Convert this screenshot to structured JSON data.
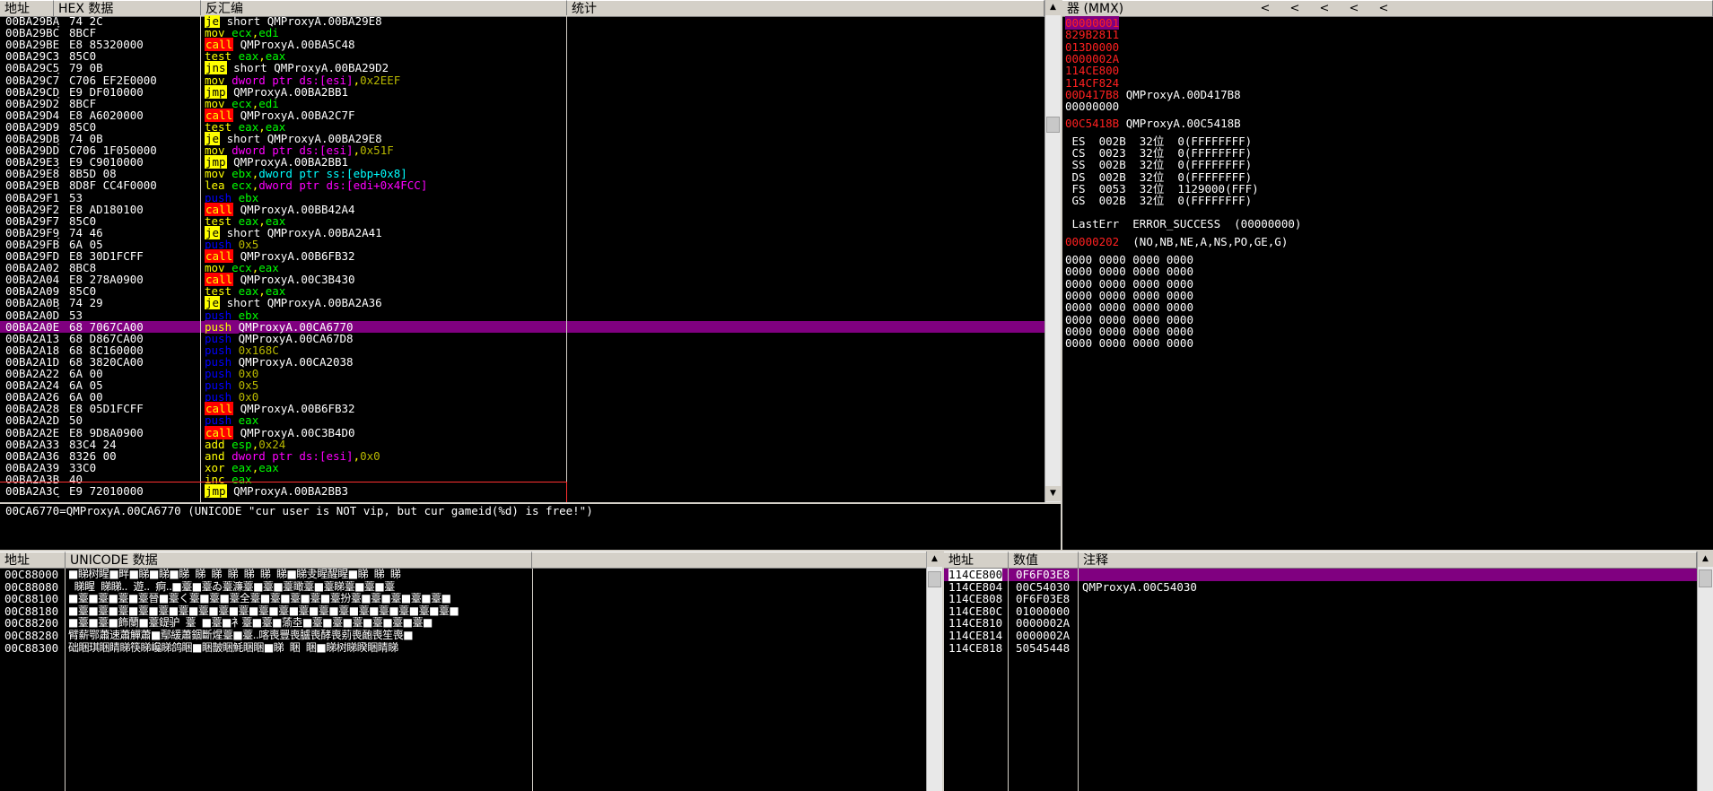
{
  "disasm": {
    "headers": {
      "addr": "地址",
      "hex": "HEX 数据",
      "asm": "反汇编",
      "comment": "统计"
    },
    "rows": [
      {
        "a": "00BA29BA",
        "m": "˯",
        "h": "74 2C",
        "i": [
          {
            "t": "je",
            "c": "k_je"
          },
          {
            "t": " short QMProxyA.00BA29E8",
            "c": "w"
          }
        ]
      },
      {
        "a": "00BA29BC",
        "m": "",
        "h": "8BCF",
        "i": [
          {
            "t": "mov ",
            "c": "y"
          },
          {
            "t": "ecx",
            "c": "g"
          },
          {
            "t": ",",
            "c": "y"
          },
          {
            "t": "edi",
            "c": "g"
          }
        ]
      },
      {
        "a": "00BA29BE",
        "m": "",
        "h": "E8 85320000",
        "i": [
          {
            "t": "call",
            "c": "k_call"
          },
          {
            "t": " QMProxyA.00BA5C48",
            "c": "w"
          }
        ]
      },
      {
        "a": "00BA29C3",
        "m": "",
        "h": "85C0",
        "i": [
          {
            "t": "test ",
            "c": "y"
          },
          {
            "t": "eax",
            "c": "g"
          },
          {
            "t": ",",
            "c": "y"
          },
          {
            "t": "eax",
            "c": "g"
          }
        ]
      },
      {
        "a": "00BA29C5",
        "m": "˯",
        "h": "79 0B",
        "i": [
          {
            "t": "jns",
            "c": "k_je"
          },
          {
            "t": " short QMProxyA.00BA29D2",
            "c": "w"
          }
        ]
      },
      {
        "a": "00BA29C7",
        "m": "",
        "h": "C706 EF2E0000",
        "i": [
          {
            "t": "mov ",
            "c": "y"
          },
          {
            "t": "dword ptr ",
            "c": "m"
          },
          {
            "t": "ds:[esi]",
            "c": "m"
          },
          {
            "t": ",",
            "c": "y"
          },
          {
            "t": "0x2EEF",
            "c": "o"
          }
        ]
      },
      {
        "a": "00BA29CD",
        "m": "˯",
        "h": "E9 DF010000",
        "i": [
          {
            "t": "jmp",
            "c": "k_jmp"
          },
          {
            "t": " QMProxyA.00BA2BB1",
            "c": "w"
          }
        ]
      },
      {
        "a": "00BA29D2",
        "m": "",
        "h": "8BCF",
        "i": [
          {
            "t": "mov ",
            "c": "y"
          },
          {
            "t": "ecx",
            "c": "g"
          },
          {
            "t": ",",
            "c": "y"
          },
          {
            "t": "edi",
            "c": "g"
          }
        ]
      },
      {
        "a": "00BA29D4",
        "m": "",
        "h": "E8 A6020000",
        "i": [
          {
            "t": "call",
            "c": "k_call"
          },
          {
            "t": " QMProxyA.00BA2C7F",
            "c": "w"
          }
        ]
      },
      {
        "a": "00BA29D9",
        "m": "",
        "h": "85C0",
        "i": [
          {
            "t": "test ",
            "c": "y"
          },
          {
            "t": "eax",
            "c": "g"
          },
          {
            "t": ",",
            "c": "y"
          },
          {
            "t": "eax",
            "c": "g"
          }
        ]
      },
      {
        "a": "00BA29DB",
        "m": "˯",
        "h": "74 0B",
        "i": [
          {
            "t": "je",
            "c": "k_je"
          },
          {
            "t": " short QMProxyA.00BA29E8",
            "c": "w"
          }
        ]
      },
      {
        "a": "00BA29DD",
        "m": "",
        "h": "C706 1F050000",
        "i": [
          {
            "t": "mov ",
            "c": "y"
          },
          {
            "t": "dword ptr ",
            "c": "m"
          },
          {
            "t": "ds:[esi]",
            "c": "m"
          },
          {
            "t": ",",
            "c": "y"
          },
          {
            "t": "0x51F",
            "c": "o"
          }
        ]
      },
      {
        "a": "00BA29E3",
        "m": "˯",
        "h": "E9 C9010000",
        "i": [
          {
            "t": "jmp",
            "c": "k_jmp"
          },
          {
            "t": " QMProxyA.00BA2BB1",
            "c": "w"
          }
        ]
      },
      {
        "a": "00BA29E8",
        "m": "",
        "h": "8B5D 08",
        "i": [
          {
            "t": "mov ",
            "c": "y"
          },
          {
            "t": "ebx",
            "c": "g"
          },
          {
            "t": ",",
            "c": "y"
          },
          {
            "t": "dword ptr ss:[ebp+0x8]",
            "c": "cy"
          }
        ]
      },
      {
        "a": "00BA29EB",
        "m": "",
        "h": "8D8F CC4F0000",
        "i": [
          {
            "t": "lea ",
            "c": "y"
          },
          {
            "t": "ecx",
            "c": "g"
          },
          {
            "t": ",",
            "c": "y"
          },
          {
            "t": "dword ptr ds:[edi+0x4FCC]",
            "c": "m"
          }
        ]
      },
      {
        "a": "00BA29F1",
        "m": "",
        "h": "53",
        "i": [
          {
            "t": "push ",
            "c": "b"
          },
          {
            "t": "ebx",
            "c": "g"
          }
        ]
      },
      {
        "a": "00BA29F2",
        "m": "",
        "h": "E8 AD180100",
        "i": [
          {
            "t": "call",
            "c": "k_call"
          },
          {
            "t": " QMProxyA.00BB42A4",
            "c": "w"
          }
        ]
      },
      {
        "a": "00BA29F7",
        "m": "",
        "h": "85C0",
        "i": [
          {
            "t": "test ",
            "c": "y"
          },
          {
            "t": "eax",
            "c": "g"
          },
          {
            "t": ",",
            "c": "y"
          },
          {
            "t": "eax",
            "c": "g"
          }
        ]
      },
      {
        "a": "00BA29F9",
        "m": "˯",
        "h": "74 46",
        "i": [
          {
            "t": "je",
            "c": "k_je"
          },
          {
            "t": " short QMProxyA.00BA2A41",
            "c": "w"
          }
        ]
      },
      {
        "a": "00BA29FB",
        "m": "",
        "h": "6A 05",
        "i": [
          {
            "t": "push ",
            "c": "b"
          },
          {
            "t": "0x5",
            "c": "o"
          }
        ]
      },
      {
        "a": "00BA29FD",
        "m": "",
        "h": "E8 30D1FCFF",
        "i": [
          {
            "t": "call",
            "c": "k_call"
          },
          {
            "t": " QMProxyA.00B6FB32",
            "c": "w"
          }
        ]
      },
      {
        "a": "00BA2A02",
        "m": "",
        "h": "8BC8",
        "i": [
          {
            "t": "mov ",
            "c": "y"
          },
          {
            "t": "ecx",
            "c": "g"
          },
          {
            "t": ",",
            "c": "y"
          },
          {
            "t": "eax",
            "c": "g"
          }
        ]
      },
      {
        "a": "00BA2A04",
        "m": "",
        "h": "E8 278A0900",
        "i": [
          {
            "t": "call",
            "c": "k_call"
          },
          {
            "t": " QMProxyA.00C3B430",
            "c": "w"
          }
        ]
      },
      {
        "a": "00BA2A09",
        "m": "",
        "h": "85C0",
        "i": [
          {
            "t": "test ",
            "c": "y"
          },
          {
            "t": "eax",
            "c": "g"
          },
          {
            "t": ",",
            "c": "y"
          },
          {
            "t": "eax",
            "c": "g"
          }
        ]
      },
      {
        "a": "00BA2A0B",
        "m": "˯",
        "h": "74 29",
        "i": [
          {
            "t": "je",
            "c": "k_je"
          },
          {
            "t": " short QMProxyA.00BA2A36",
            "c": "w"
          }
        ]
      },
      {
        "a": "00BA2A0D",
        "m": "",
        "h": "53",
        "i": [
          {
            "t": "push ",
            "c": "b"
          },
          {
            "t": "ebx",
            "c": "g"
          }
        ]
      },
      {
        "a": "00BA2A0E",
        "m": "",
        "h": "68 7067CA00",
        "sel": true,
        "i": [
          {
            "t": "push ",
            "c": "b"
          },
          {
            "t": "QMProxyA.00CA6770",
            "c": "w"
          }
        ]
      },
      {
        "a": "00BA2A13",
        "m": "",
        "h": "68 D867CA00",
        "i": [
          {
            "t": "push ",
            "c": "b"
          },
          {
            "t": "QMProxyA.00CA67D8",
            "c": "w"
          }
        ]
      },
      {
        "a": "00BA2A18",
        "m": "",
        "h": "68 8C160000",
        "i": [
          {
            "t": "push ",
            "c": "b"
          },
          {
            "t": "0x168C",
            "c": "o"
          }
        ]
      },
      {
        "a": "00BA2A1D",
        "m": "",
        "h": "68 3820CA00",
        "i": [
          {
            "t": "push ",
            "c": "b"
          },
          {
            "t": "QMProxyA.00CA2038",
            "c": "w"
          }
        ]
      },
      {
        "a": "00BA2A22",
        "m": "",
        "h": "6A 00",
        "i": [
          {
            "t": "push ",
            "c": "b"
          },
          {
            "t": "0x0",
            "c": "o"
          }
        ]
      },
      {
        "a": "00BA2A24",
        "m": "",
        "h": "6A 05",
        "i": [
          {
            "t": "push ",
            "c": "b"
          },
          {
            "t": "0x5",
            "c": "o"
          }
        ]
      },
      {
        "a": "00BA2A26",
        "m": "",
        "h": "6A 00",
        "i": [
          {
            "t": "push ",
            "c": "b"
          },
          {
            "t": "0x0",
            "c": "o"
          }
        ]
      },
      {
        "a": "00BA2A28",
        "m": "",
        "h": "E8 05D1FCFF",
        "i": [
          {
            "t": "call",
            "c": "k_call"
          },
          {
            "t": " QMProxyA.00B6FB32",
            "c": "w"
          }
        ]
      },
      {
        "a": "00BA2A2D",
        "m": "",
        "h": "50",
        "i": [
          {
            "t": "push ",
            "c": "b"
          },
          {
            "t": "eax",
            "c": "g"
          }
        ]
      },
      {
        "a": "00BA2A2E",
        "m": "",
        "h": "E8 9D8A0900",
        "i": [
          {
            "t": "call",
            "c": "k_call"
          },
          {
            "t": " QMProxyA.00C3B4D0",
            "c": "w"
          }
        ]
      },
      {
        "a": "00BA2A33",
        "m": "",
        "h": "83C4 24",
        "i": [
          {
            "t": "add ",
            "c": "y"
          },
          {
            "t": "esp",
            "c": "g"
          },
          {
            "t": ",",
            "c": "y"
          },
          {
            "t": "0x24",
            "c": "o"
          }
        ]
      },
      {
        "a": "00BA2A36",
        "m": "",
        "h": "8326 00",
        "i": [
          {
            "t": "and ",
            "c": "y"
          },
          {
            "t": "dword ptr ",
            "c": "m"
          },
          {
            "t": "ds:[esi]",
            "c": "m"
          },
          {
            "t": ",",
            "c": "y"
          },
          {
            "t": "0x0",
            "c": "o"
          }
        ]
      },
      {
        "a": "00BA2A39",
        "m": "",
        "h": "33C0",
        "i": [
          {
            "t": "xor ",
            "c": "y"
          },
          {
            "t": "eax",
            "c": "g"
          },
          {
            "t": ",",
            "c": "y"
          },
          {
            "t": "eax",
            "c": "g"
          }
        ]
      },
      {
        "a": "00BA2A3B",
        "m": "",
        "h": "40",
        "i": [
          {
            "t": "inc ",
            "c": "y"
          },
          {
            "t": "eax",
            "c": "g"
          }
        ]
      },
      {
        "a": "00BA2A3C",
        "m": "˯",
        "h": "E9 72010000",
        "i": [
          {
            "t": "jmp",
            "c": "k_jmp"
          },
          {
            "t": " QMProxyA.00BA2BB3",
            "c": "w"
          }
        ]
      }
    ],
    "info_line": "00CA6770=QMProxyA.00CA6770 (UNICODE \"cur user is NOT vip, but cur gameid(%d) is free!\")"
  },
  "registers": {
    "header": "器 (MMX)",
    "nav_buttons": [
      "<",
      "<",
      "<",
      "<",
      "<"
    ],
    "gpr": [
      {
        "v": "00000001",
        "s": "",
        "hl": true
      },
      {
        "v": "829B2811",
        "s": ""
      },
      {
        "v": "013D0000",
        "s": ""
      },
      {
        "v": "0000002A",
        "s": ""
      },
      {
        "v": "114CE800",
        "s": ""
      },
      {
        "v": "114CF824",
        "s": ""
      },
      {
        "v": "00D417B8",
        "s": " QMProxyA.00D417B8"
      },
      {
        "v": "00000000",
        "s": "",
        "white": true
      }
    ],
    "eip": {
      "v": "00C5418B",
      "s": " QMProxyA.00C5418B"
    },
    "segments": [
      " ES  002B  32位  0(FFFFFFFF)",
      " CS  0023  32位  0(FFFFFFFF)",
      " SS  002B  32位  0(FFFFFFFF)",
      " DS  002B  32位  0(FFFFFFFF)",
      " FS  0053  32位  1129000(FFF)",
      " GS  002B  32位  0(FFFFFFFF)"
    ],
    "lasterr": " LastErr  ERROR_SUCCESS  (00000000)",
    "efl_value": "00000202",
    "efl_text": "  (NO,NB,NE,A,NS,PO,GE,G)",
    "mmx": [
      "0000 0000 0000 0000",
      "0000 0000 0000 0000",
      "0000 0000 0000 0000",
      "0000 0000 0000 0000",
      "0000 0000 0000 0000",
      "0000 0000 0000 0000",
      "0000 0000 0000 0000",
      "0000 0000 0000 0000"
    ]
  },
  "dump": {
    "headers": {
      "addr": "地址",
      "data": "UNICODE 数据"
    },
    "rows": [
      {
        "a": "00C88000",
        "d": "■睇树睲■畔■睇■睇■睇  睇  睇  睇  睇  睇  睇■睇叏睲醒睲■睇  睇  睇"
      },
      {
        "a": "00C88080",
        "d": "  睇睲  睇睇..  遊..  痾..■薹■薹ゐ薹濂薹■薹■薹瞰薹■薹睇薹■薹■薹"
      },
      {
        "a": "00C88100",
        "d": "■薹■薹■薹■薹晉■薹く薹■薹■薹全薹■薹■薹■薹■薹扮薹■薹■薹■薹■薹■"
      },
      {
        "a": "00C88180",
        "d": "■薹■薹■薹■薹■薹■薹■薹■薹■薹■薹■薹■薹■薹■薹■薹■薹■薹■薹■薹■"
      },
      {
        "a": "00C88200",
        "d": "■薹■薹■飾蘭■薹鍉驴  薹  ■薹■衤薹■薹■蕍坴■薹■薹■薹■薹■薹■薹■"
      },
      {
        "a": "00C88280",
        "d": "臂薪鄂蕭速蕭觶蕭■鄢緩蕭錮斷煋薹■薹..喀喪豐喪臚喪酵喪莂喪靤喪笙喪■"
      },
      {
        "a": "00C88300",
        "d": "础睏琪睏睛睇筷睇巉睇鸽睏■睏皵睏魹睏睏■睇  睏  睏■睇树睇睽睏睛睇"
      }
    ]
  },
  "stack": {
    "headers": {
      "addr": "地址",
      "value": "数值",
      "comment": "注释"
    },
    "rows": [
      {
        "a": "114CE800",
        "v": "0F6F03E8",
        "c": "",
        "sel": true
      },
      {
        "a": "114CE804",
        "v": "00C54030",
        "c": "QMProxyA.00C54030"
      },
      {
        "a": "114CE808",
        "v": "0F6F03E8",
        "c": ""
      },
      {
        "a": "114CE80C",
        "v": "01000000",
        "c": ""
      },
      {
        "a": "114CE810",
        "v": "0000002A",
        "c": ""
      },
      {
        "a": "114CE814",
        "v": "0000002A",
        "c": ""
      },
      {
        "a": "114CE818",
        "v": "50545448",
        "c": ""
      }
    ]
  },
  "colors": {
    "selection": "#800080",
    "register_red": "#ff2020",
    "call_bg": "#ff0000",
    "jump_bg": "#ffff00"
  }
}
